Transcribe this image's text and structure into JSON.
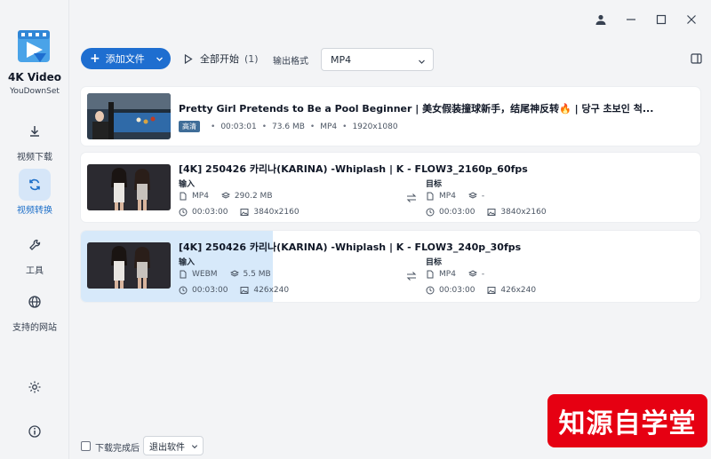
{
  "brand": {
    "name": "4K Video",
    "sub": "YouDownSet"
  },
  "sidebar": {
    "items": [
      {
        "label": "视频下载",
        "icon": "download-icon"
      },
      {
        "label": "视频转换",
        "icon": "convert-icon",
        "active": true
      },
      {
        "label": "工具",
        "icon": "wrench-icon"
      },
      {
        "label": "支持的网站",
        "icon": "globe-icon"
      }
    ],
    "bottom_icons": [
      "settings-icon",
      "info-icon"
    ]
  },
  "toolbar": {
    "add_label": "添加文件",
    "start_label": "全部开始",
    "start_count": "(1)",
    "format_label": "输出格式",
    "format_value": "MP4"
  },
  "items": [
    {
      "title": "Pretty Girl Pretends to Be a Pool Beginner | 美女假装撞球新手，结尾神反转🔥 | 당구 초보인 척...",
      "badge": "高清",
      "duration": "00:03:01",
      "size": "73.6 MB",
      "format": "MP4",
      "resolution": "1920x1080"
    },
    {
      "title": "[4K] 250426 카리나(KARINA) -Whiplash  |  K - FLOW3_2160p_60fps",
      "input_label": "输入",
      "target_label": "目标",
      "in_format": "MP4",
      "in_size": "290.2 MB",
      "in_duration": "00:03:00",
      "in_resolution": "3840x2160",
      "out_format": "MP4",
      "out_size": "-",
      "out_duration": "00:03:00",
      "out_resolution": "3840x2160"
    },
    {
      "title": "[4K] 250426 카리나(KARINA) -Whiplash  |  K - FLOW3_240p_30fps",
      "input_label": "输入",
      "target_label": "目标",
      "in_format": "WEBM",
      "in_size": "5.5 MB",
      "in_duration": "00:03:00",
      "in_resolution": "426x240",
      "out_format": "MP4",
      "out_size": "-",
      "out_duration": "00:03:00",
      "out_resolution": "426x240",
      "progress": 0.31
    }
  ],
  "bottom": {
    "after_label": "下载完成后",
    "after_value": "退出软件"
  },
  "watermark": "知源自学堂",
  "colors": {
    "accent": "#1e6ed0",
    "active_bg": "#d6e6f8",
    "watermark": "#e60012"
  }
}
